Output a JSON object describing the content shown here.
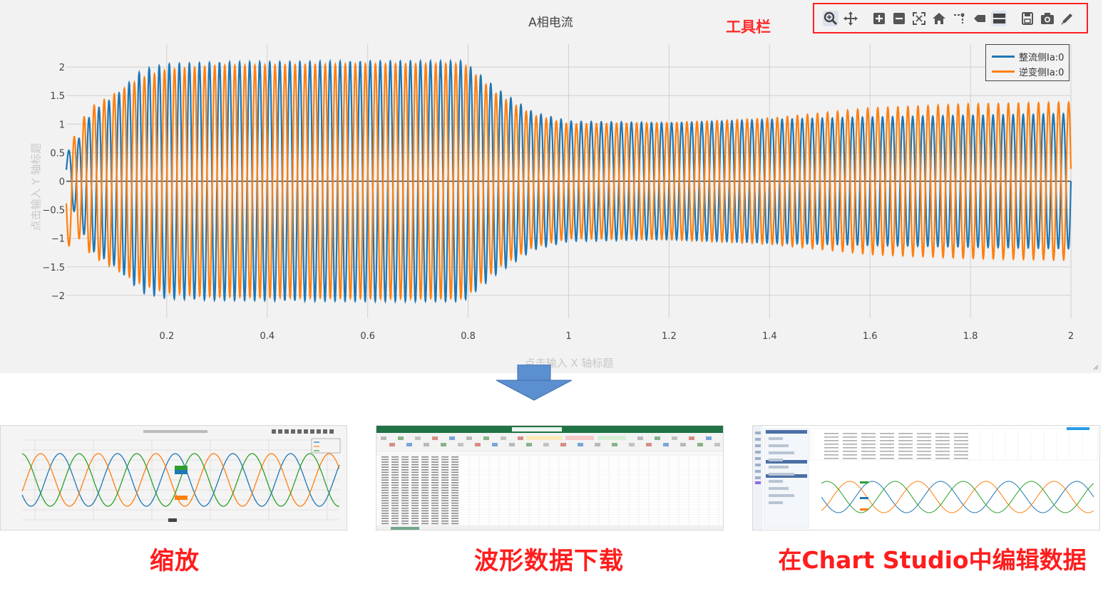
{
  "chart": {
    "title": "A相电流",
    "xaxis_title_placeholder": "点击输入 X 轴标题",
    "yaxis_title_placeholder": "点击输入 Y 轴标题",
    "toolbar_annotation": "工具栏",
    "modebar_buttons": [
      {
        "name": "zoom-icon",
        "active": true
      },
      {
        "name": "pan-icon",
        "active": false
      },
      {
        "name": "zoom-in-icon",
        "active": false
      },
      {
        "name": "zoom-out-icon",
        "active": false
      },
      {
        "name": "autoscale-icon",
        "active": false
      },
      {
        "name": "reset-axes-icon",
        "active": false
      },
      {
        "name": "spike-lines-icon",
        "active": false
      },
      {
        "name": "hover-closest-icon",
        "active": false
      },
      {
        "name": "hover-compare-icon",
        "active": true
      },
      {
        "name": "download-data-icon",
        "active": false
      },
      {
        "name": "camera-icon",
        "active": false
      },
      {
        "name": "edit-in-chart-studio-icon",
        "active": false
      }
    ]
  },
  "chart_data": {
    "type": "line",
    "title": "A相电流",
    "xlabel": "点击输入 X 轴标题",
    "ylabel": "点击输入 Y 轴标题",
    "xlim": [
      0,
      2
    ],
    "ylim": [
      -2.4,
      2.4
    ],
    "x_ticks": [
      "0.2",
      "0.4",
      "0.6",
      "0.8",
      "1",
      "1.2",
      "1.4",
      "1.6",
      "1.8",
      "2"
    ],
    "y_ticks": [
      "2",
      "1.5",
      "1",
      "0.5",
      "0",
      "−0.5",
      "−1",
      "−1.5",
      "−2"
    ],
    "grid": true,
    "legend_position": "top-right",
    "frequency_hz": 50,
    "series": [
      {
        "name": "整流侧Ia:0",
        "color": "#1f77b4",
        "envelope": [
          [
            0.0,
            0.3
          ],
          [
            0.05,
            1.2
          ],
          [
            0.1,
            1.5
          ],
          [
            0.15,
            1.95
          ],
          [
            0.2,
            2.05
          ],
          [
            0.3,
            2.08
          ],
          [
            0.6,
            2.1
          ],
          [
            0.79,
            2.1
          ],
          [
            0.86,
            1.6
          ],
          [
            0.93,
            1.2
          ],
          [
            1.0,
            1.05
          ],
          [
            1.2,
            1.02
          ],
          [
            1.4,
            1.08
          ],
          [
            1.6,
            1.12
          ],
          [
            1.8,
            1.15
          ],
          [
            2.0,
            1.18
          ]
        ]
      },
      {
        "name": "逆变侧Ia:0",
        "color": "#ff7f0e",
        "envelope": [
          [
            0.0,
            0.7
          ],
          [
            0.05,
            1.3
          ],
          [
            0.1,
            1.55
          ],
          [
            0.15,
            1.8
          ],
          [
            0.2,
            1.95
          ],
          [
            0.3,
            2.02
          ],
          [
            0.6,
            2.05
          ],
          [
            0.79,
            2.05
          ],
          [
            0.86,
            1.5
          ],
          [
            0.93,
            1.15
          ],
          [
            1.0,
            1.0
          ],
          [
            1.2,
            1.02
          ],
          [
            1.4,
            1.1
          ],
          [
            1.6,
            1.28
          ],
          [
            1.8,
            1.35
          ],
          [
            2.0,
            1.38
          ]
        ]
      }
    ]
  },
  "captions": {
    "zoom": "缩放",
    "download": "波形数据下载",
    "studio": "在Chart Studio中编辑数据"
  }
}
